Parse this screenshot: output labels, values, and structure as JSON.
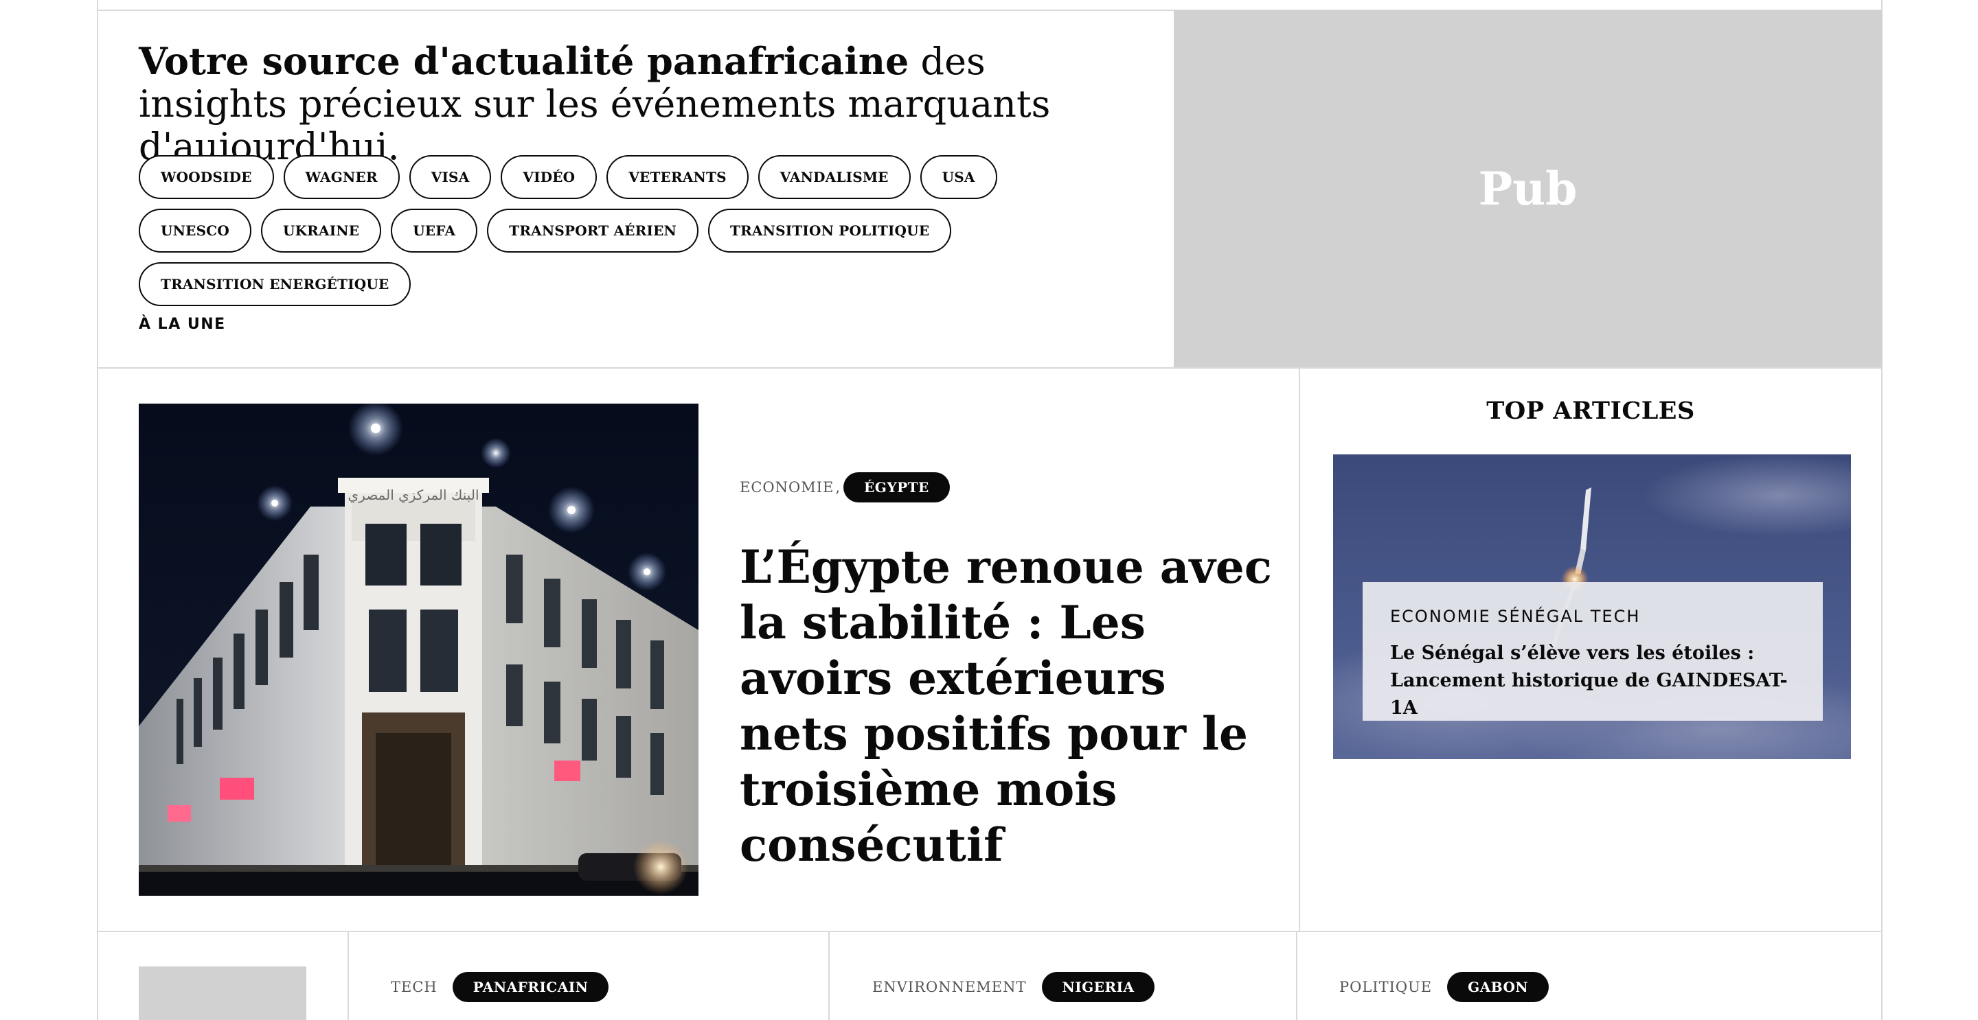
{
  "intro": {
    "headline_bold": "Votre source d'actualité panafricaine",
    "headline_rest": " des insights précieux sur les événements marquants d'aujourd'hui.",
    "tags": [
      "WOODSIDE",
      "WAGNER",
      "VISA",
      "VIDÉO",
      "VETERANTS",
      "VANDALISME",
      "USA",
      "UNESCO",
      "UKRAINE",
      "UEFA",
      "TRANSPORT AÉRIEN",
      "TRANSITION POLITIQUE",
      "TRANSITION ENERGÉTIQUE"
    ],
    "section_label": "À LA UNE"
  },
  "ad": {
    "label": "Pub"
  },
  "featured": {
    "category": "ECONOMIE",
    "separator": ",",
    "tag": "ÉGYPTE",
    "title": "L’Égypte renoue avec la stabilité : Les avoirs extérieurs nets positifs pour le troisième mois consécutif",
    "image_inscription": "البنك المركزي المصري"
  },
  "top_articles": {
    "title": "TOP ARTICLES",
    "items": [
      {
        "categories": "ECONOMIE SÉNÉGAL TECH",
        "title": "Le Sénégal s’élève vers les étoiles : Lancement historique de GAINDESAT-1A"
      }
    ]
  },
  "bottom_row": [
    {
      "category": "TECH",
      "tag": "PANAFRICAIN"
    },
    {
      "category": "ENVIRONNEMENT",
      "tag": "NIGERIA"
    },
    {
      "category": "POLITIQUE",
      "tag": "GABON"
    }
  ],
  "colors": {
    "ink": "#0a0a0a",
    "rule": "#d9d9d9",
    "placeholder": "#d1d1d1",
    "muted": "#555555"
  }
}
